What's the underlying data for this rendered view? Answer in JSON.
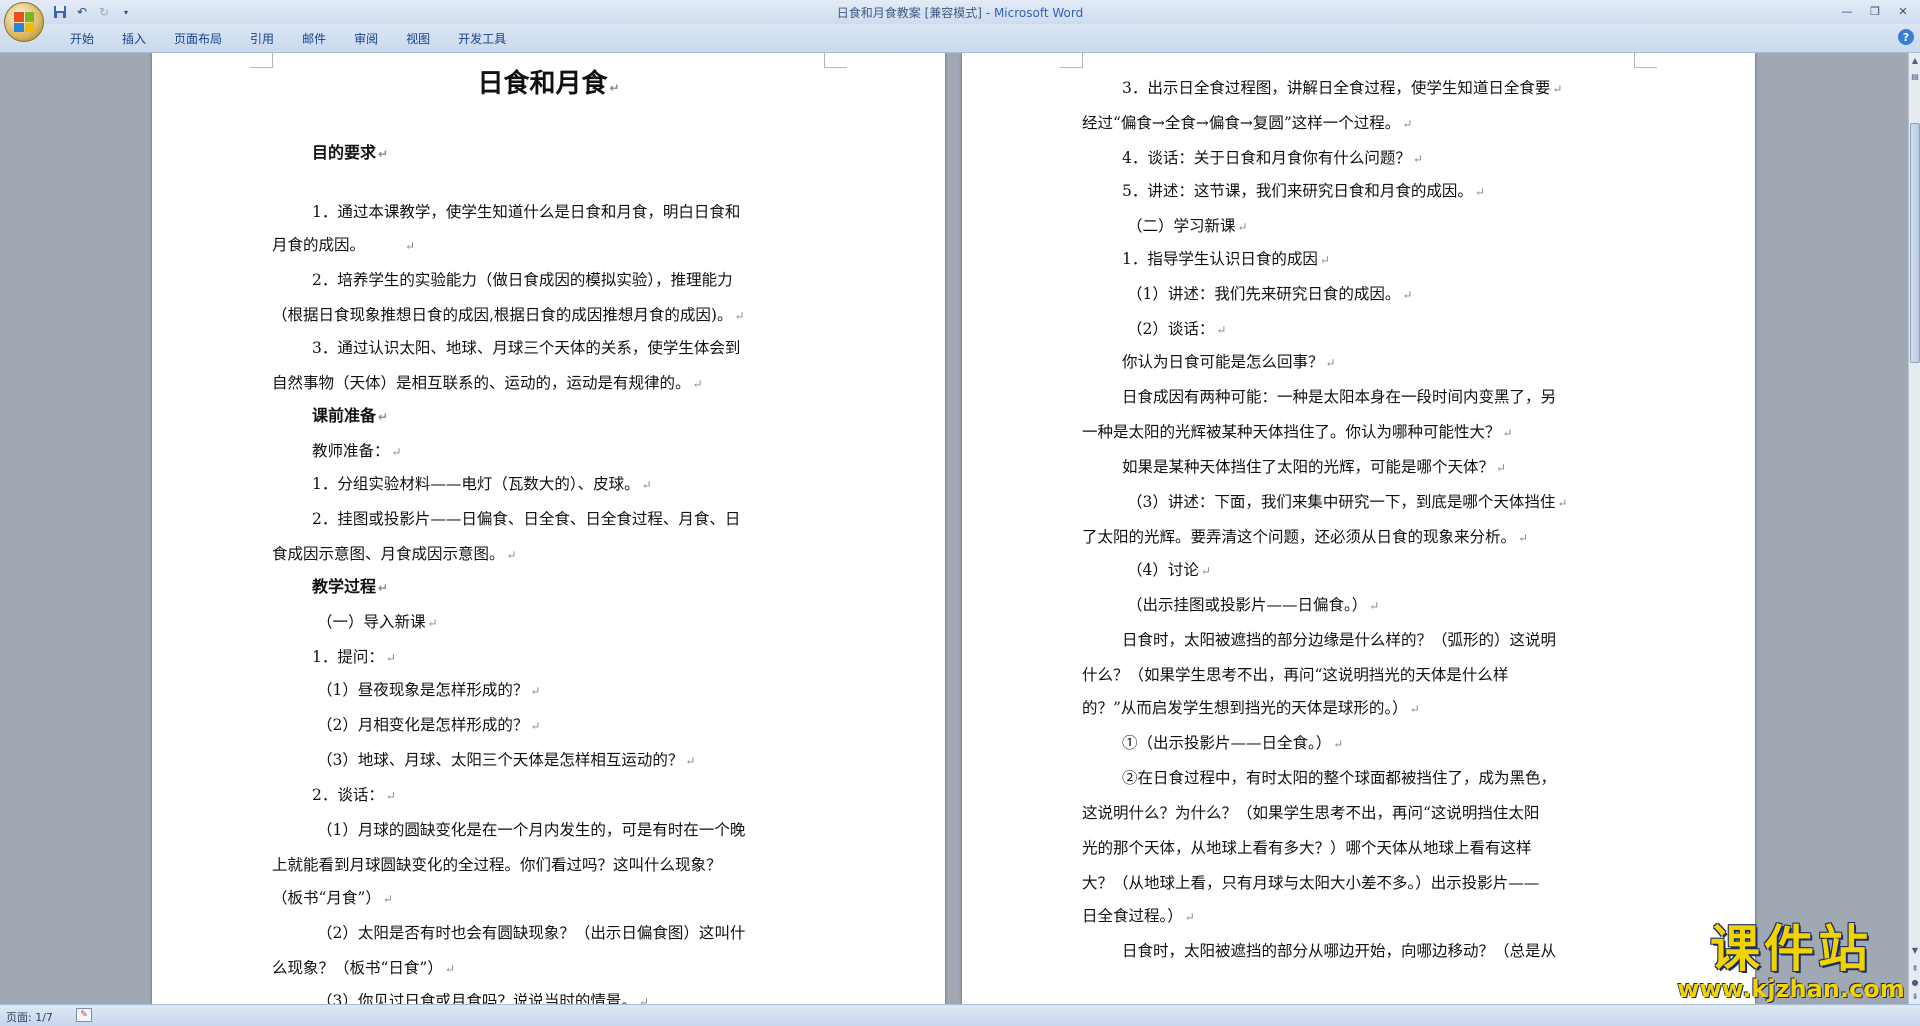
{
  "window": {
    "doc_title": "日食和月食教案 [兼容模式]",
    "separator": " - ",
    "app_name": "Microsoft Word"
  },
  "ribbon": {
    "tabs": [
      "开始",
      "插入",
      "页面布局",
      "引用",
      "邮件",
      "审阅",
      "视图",
      "开发工具"
    ]
  },
  "status": {
    "page_info": "页面: 1/7"
  },
  "watermark": {
    "cn": "课件站",
    "url": "www.kjzhan.com"
  },
  "page1": {
    "title": "日食和月食",
    "lines": [
      "目的要求",
      "1．通过本课教学，使学生知道什么是日食和月食，明白日食和",
      "月食的成因。",
      "2．培养学生的实验能力（做日食成因的模拟实验），推理能力",
      "（根据日食现象推想日食的成因,根据日食的成因推想月食的成因)。",
      "3．通过认识太阳、地球、月球三个天体的关系，使学生体会到",
      "自然事物（天体）是相互联系的、运动的，运动是有规律的。",
      "课前准备",
      "教师准备：",
      "1．分组实验材料——电灯（瓦数大的）、皮球。",
      "2．挂图或投影片——日偏食、日全食、日全食过程、月食、日",
      "食成因示意图、月食成因示意图。",
      "教学过程",
      "（一）导入新课",
      "1．提问：",
      "（1）昼夜现象是怎样形成的？",
      "（2）月相变化是怎样形成的？",
      "（3）地球、月球、太阳三个天体是怎样相互运动的？",
      "2．谈话：",
      "（1）月球的圆缺变化是在一个月内发生的，可是有时在一个晚",
      "上就能看到月球圆缺变化的全过程。你们看过吗？这叫什么现象？",
      "（板书“月食”）",
      "（2）太阳是否有时也会有圆缺现象？（出示日偏食图）这叫什",
      "么现象？（板书“日食”）",
      "（3）你见过日食或月食吗？说说当时的情景。"
    ]
  },
  "page2": {
    "lines": [
      "3．出示日全食过程图，讲解日全食过程，使学生知道日全食要",
      "经过“偏食→全食→偏食→复圆”这样一个过程。",
      "4．谈话：关于日食和月食你有什么问题？",
      "5．讲述：这节课，我们来研究日食和月食的成因。",
      "（二）学习新课",
      "1．指导学生认识日食的成因",
      "（1）讲述：我们先来研究日食的成因。",
      "（2）谈话：",
      "你认为日食可能是怎么回事？",
      "日食成因有两种可能：一种是太阳本身在一段时间内变黑了，另",
      "一种是太阳的光辉被某种天体挡住了。你认为哪种可能性大？",
      "如果是某种天体挡住了太阳的光辉，可能是哪个天体？",
      "（3）讲述：下面，我们来集中研究一下，到底是哪个天体挡住",
      "了太阳的光辉。要弄清这个问题，还必须从日食的现象来分析。",
      "（4）讨论",
      "（出示挂图或投影片——日偏食。）",
      "日食时，太阳被遮挡的部分边缘是什么样的？（弧形的）这说明",
      "什么？（如果学生思考不出，再问“这说明挡光的天体是什么样",
      "的？”从而启发学生想到挡光的天体是球形的。）",
      "①（出示投影片——日全食。）",
      "②在日食过程中，有时太阳的整个球面都被挡住了，成为黑色，",
      "这说明什么？为什么？（如果学生思考不出，再问“这说明挡住太阳",
      "光的那个天体，从地球上看有多大？）哪个天体从地球上看有这样",
      "大？（从地球上看，只有月球与太阳大小差不多。）出示投影片——",
      "日全食过程。）",
      "日食时，太阳被遮挡的部分从哪边开始，向哪边移动？（总是从"
    ]
  }
}
